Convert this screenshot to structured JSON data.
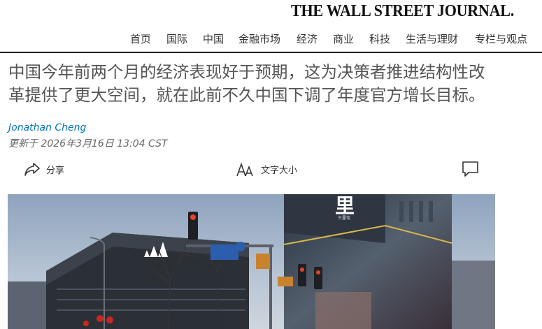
{
  "masthead": "THE WALL STREET JOURNAL.",
  "nav": {
    "items": [
      {
        "label": "首页"
      },
      {
        "label": "国际"
      },
      {
        "label": "中国"
      },
      {
        "label": "金融市场"
      },
      {
        "label": "经济"
      },
      {
        "label": "商业"
      },
      {
        "label": "科技"
      },
      {
        "label": "生活与理财"
      },
      {
        "label": "专栏与观点"
      }
    ]
  },
  "article": {
    "headline": "中国今年前两个月的经济表现好于预期，这为决策者推进结构性改革提供了更大空间，就在此前不久中国下调了年度官方增长目标。",
    "author": "Jonathan Cheng",
    "updated": "更新于 2026年3月16日 13:04 CST"
  },
  "tools": {
    "share_label": "分享",
    "textsize_label": "文字大小",
    "share_icon": "share-arrow-icon",
    "textsize_icon": "text-size-icon",
    "comment_icon": "comment-bubble-icon"
  },
  "hero_image": {
    "sign_text": "里",
    "sign_subtext": "三里屯"
  },
  "colors": {
    "author_link": "#0274b6",
    "nav_rule": "#222222"
  }
}
